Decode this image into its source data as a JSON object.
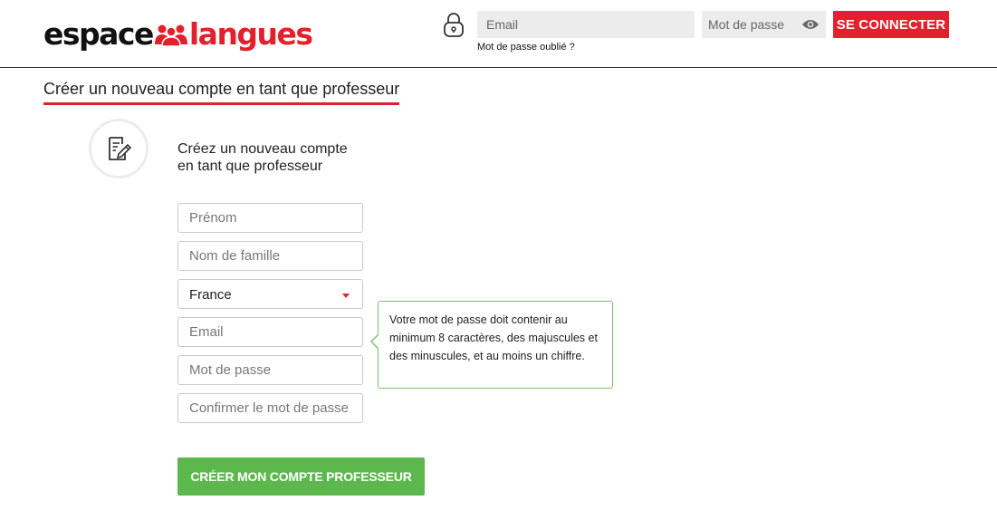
{
  "brand": {
    "logo_part1": "espace",
    "logo_part2": "langues",
    "logo_icon": "people-group-icon",
    "accent_color": "#e3202c",
    "success_color": "#5cb84c"
  },
  "login": {
    "email_placeholder": "Email",
    "password_placeholder": "Mot de passe",
    "submit_label": "SE CONNECTER",
    "forgot_label": "Mot de passe oublié ?"
  },
  "page": {
    "title": "Créer un nouveau compte en tant que professeur"
  },
  "form": {
    "heading_line1": "Créez un nouveau compte",
    "heading_line2": "en tant que professeur",
    "icon": "edit-document-icon",
    "firstname_placeholder": "Prénom",
    "lastname_placeholder": "Nom de famille",
    "country_value": "France",
    "email_placeholder": "Email",
    "password_placeholder": "Mot de passe",
    "confirm_placeholder": "Confirmer le mot de passe",
    "password_hint": "Votre mot de passe doit contenir au minimum 8 caractères, des majuscules et des minuscules, et au moins un chiffre.",
    "submit_label": "CRÉER MON COMPTE PROFESSEUR"
  }
}
